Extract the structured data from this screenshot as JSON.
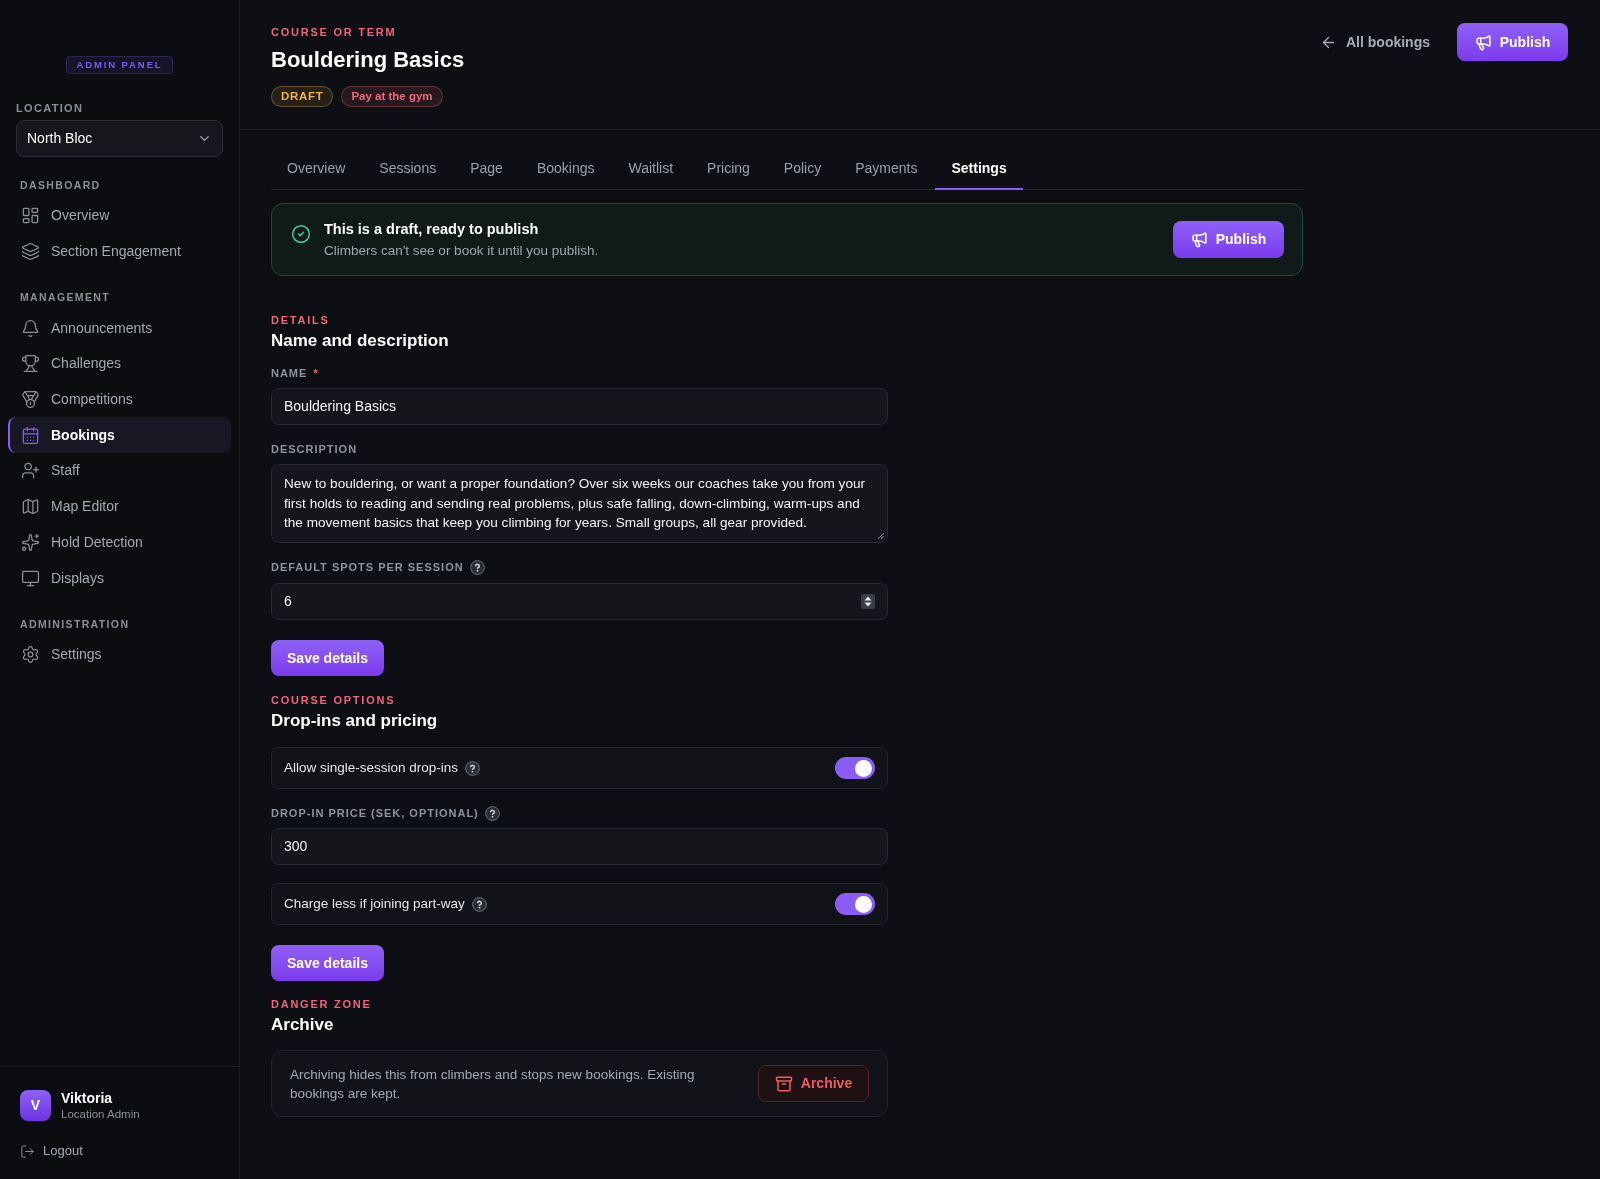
{
  "sidebar": {
    "badge": "ADMIN PANEL",
    "location": {
      "label": "LOCATION",
      "value": "North Bloc"
    },
    "sections": [
      {
        "heading": "DASHBOARD",
        "items": [
          {
            "label": "Overview",
            "selected": false
          },
          {
            "label": "Section Engagement",
            "selected": false
          }
        ]
      },
      {
        "heading": "MANAGEMENT",
        "items": [
          {
            "label": "Announcements",
            "selected": false
          },
          {
            "label": "Challenges",
            "selected": false
          },
          {
            "label": "Competitions",
            "selected": false
          },
          {
            "label": "Bookings",
            "selected": true
          },
          {
            "label": "Staff",
            "selected": false
          },
          {
            "label": "Map Editor",
            "selected": false
          },
          {
            "label": "Hold Detection",
            "selected": false
          },
          {
            "label": "Displays",
            "selected": false
          }
        ]
      },
      {
        "heading": "ADMINISTRATION",
        "items": [
          {
            "label": "Settings",
            "selected": false
          }
        ]
      }
    ],
    "user": {
      "initial": "V",
      "name": "Viktoria",
      "role": "Location Admin"
    },
    "logout": "Logout"
  },
  "header": {
    "eyebrow": "COURSE OR TERM",
    "title": "Bouldering Basics",
    "badges": [
      {
        "label": "DRAFT",
        "color": "#f0b34a"
      },
      {
        "label": "Pay at the gym",
        "color": "#f0687c"
      }
    ],
    "back_link": "All bookings",
    "publish_button": "Publish"
  },
  "tabs": [
    {
      "label": "Overview",
      "selected": false
    },
    {
      "label": "Sessions",
      "selected": false
    },
    {
      "label": "Page",
      "selected": false
    },
    {
      "label": "Bookings",
      "selected": false
    },
    {
      "label": "Waitlist",
      "selected": false
    },
    {
      "label": "Pricing",
      "selected": false
    },
    {
      "label": "Policy",
      "selected": false
    },
    {
      "label": "Payments",
      "selected": false
    },
    {
      "label": "Settings",
      "selected": true
    }
  ],
  "banner": {
    "title": "This is a draft, ready to publish",
    "text": "Climbers can't see or book it until you publish.",
    "button": "Publish"
  },
  "sections": [
    {
      "kind": "form",
      "eyebrow": "DETAILS",
      "title": "Name and description",
      "fields": [
        {
          "kind": "text",
          "label": "NAME",
          "required_mark": "*",
          "help": false,
          "value": "Bouldering Basics"
        },
        {
          "kind": "textarea",
          "label": "DESCRIPTION",
          "help": false,
          "value": "New to bouldering, or want a proper foundation? Over six weeks our coaches take you from your first holds to reading and sending real problems, plus safe falling, down-climbing, warm-ups and the movement basics that keep you climbing for years. Small groups, all gear provided."
        },
        {
          "kind": "number",
          "label": "DEFAULT SPOTS PER SESSION",
          "help": true,
          "value": "6"
        }
      ],
      "button": "Save details"
    },
    {
      "kind": "form",
      "eyebrow": "COURSE OPTIONS",
      "title": "Drop-ins and pricing",
      "fields": [
        {
          "kind": "toggle",
          "label": "Allow single-session drop-ins",
          "help": true,
          "on": true
        },
        {
          "kind": "text",
          "label": "DROP-IN PRICE (SEK, OPTIONAL)",
          "help": true,
          "value": "300"
        },
        {
          "kind": "toggle",
          "label": "Charge less if joining part-way",
          "help": true,
          "on": true
        }
      ],
      "button": "Save details"
    },
    {
      "kind": "danger",
      "eyebrow": "DANGER ZONE",
      "title": "Archive",
      "text": "Archiving hides this from climbers and stops new bookings. Existing bookings are kept.",
      "button": "Archive"
    }
  ]
}
